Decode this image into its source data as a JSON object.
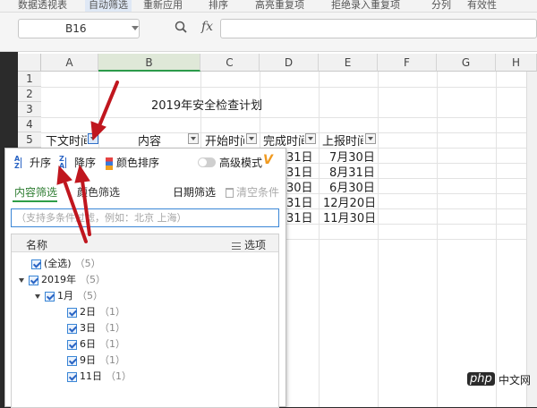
{
  "toolbar": {
    "items": [
      "数据透视表",
      "自动筛选",
      "重新应用",
      "排序",
      "高亮重复项",
      "拒绝录入重复项",
      "分列",
      "有效性"
    ]
  },
  "formula_bar": {
    "name_box": "B16",
    "fx_label": "fx",
    "formula": ""
  },
  "columns": [
    "A",
    "B",
    "C",
    "D",
    "E",
    "F",
    "G",
    "H"
  ],
  "rows": [
    "1",
    "2",
    "3",
    "4",
    "5"
  ],
  "sheet": {
    "title": "2019年安全检查计划",
    "headers": [
      "下文时间",
      "内容",
      "开始时间",
      "完成时间",
      "上报时间"
    ],
    "data_rows": [
      {
        "d": "31日",
        "e": "7月30日"
      },
      {
        "d": "31日",
        "e": "8月31日"
      },
      {
        "d": "30日",
        "e": "6月30日"
      },
      {
        "d": "31日",
        "e": "12月20日"
      },
      {
        "d": "31日",
        "e": "11月30日"
      }
    ]
  },
  "filter_panel": {
    "sort_asc": "升序",
    "sort_desc": "降序",
    "color_sort": "颜色排序",
    "advanced_mode": "高级模式",
    "tab_content": "内容筛选",
    "tab_color": "颜色筛选",
    "date_filter": "日期筛选",
    "clear": "清空条件",
    "search_placeholder": "（支持多条件过滤，例如：北京 上海）",
    "list_header": "名称",
    "options": "选项",
    "items": [
      {
        "label": "(全选)",
        "count": "（5）"
      },
      {
        "label": "2019年",
        "count": "（5）"
      },
      {
        "label": "1月",
        "count": "（5）"
      },
      {
        "label": "2日",
        "count": "（1）"
      },
      {
        "label": "3日",
        "count": "（1）"
      },
      {
        "label": "6日",
        "count": "（1）"
      },
      {
        "label": "9日",
        "count": "（1）"
      },
      {
        "label": "11日",
        "count": "（1）"
      }
    ]
  },
  "watermark": {
    "php": "php",
    "cn": "中文网"
  },
  "colors": {
    "accent_green": "#2e9e48",
    "arrow_red": "#c0161e",
    "focus_blue": "#3a86d6"
  }
}
